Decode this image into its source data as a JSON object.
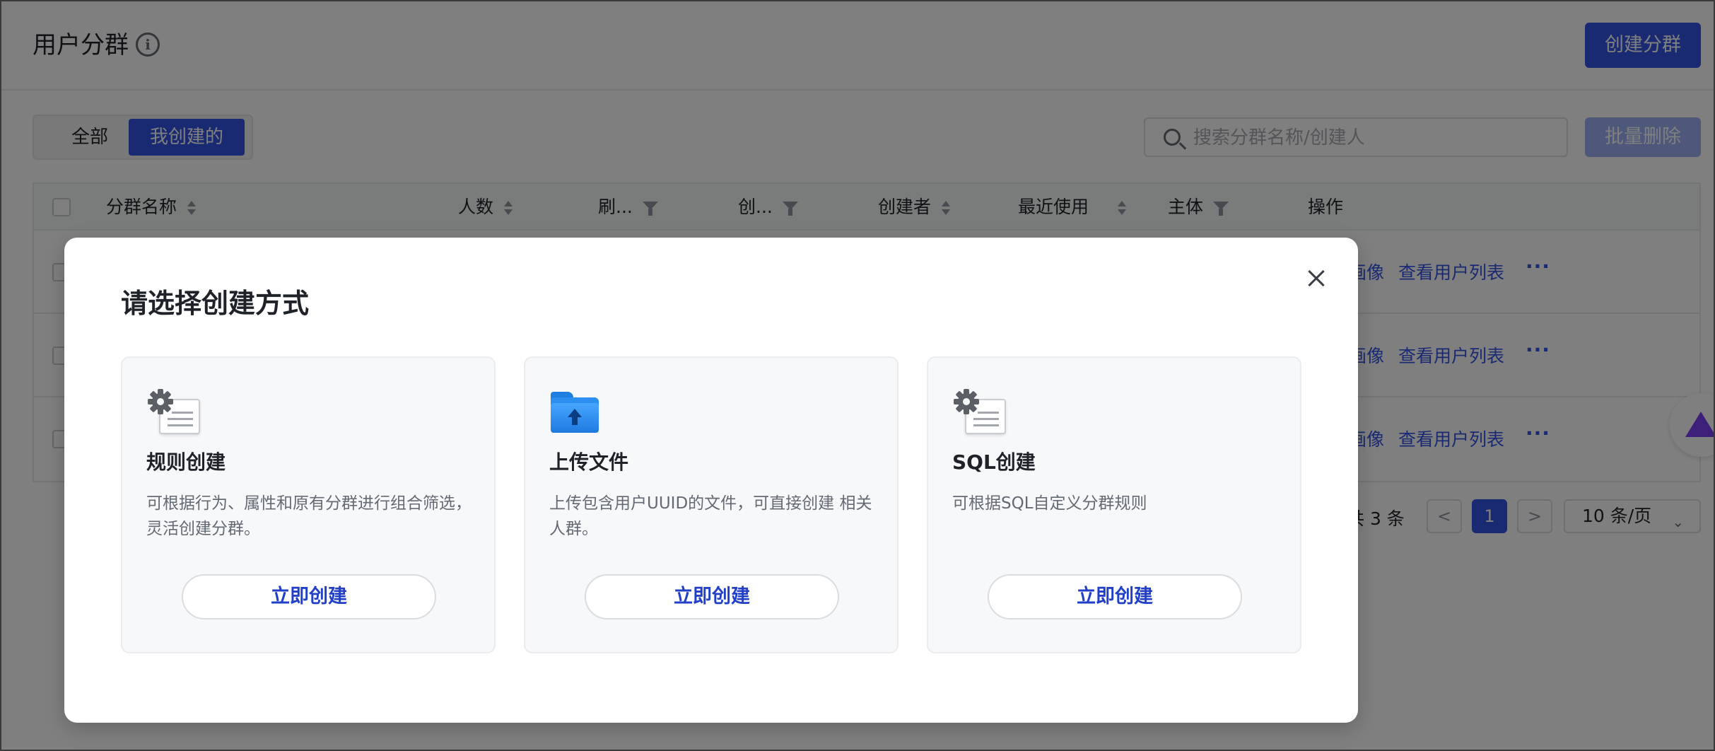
{
  "header": {
    "title": "用户分群",
    "create_button": "创建分群"
  },
  "filters": {
    "tabs": [
      "全部",
      "我创建的"
    ],
    "active_tab": "我创建的",
    "search_placeholder": "搜索分群名称/创建人",
    "batch_delete": "批量删除"
  },
  "table": {
    "columns": [
      "分群名称",
      "人数",
      "刷...",
      "创...",
      "创建者",
      "最近使用",
      "主体",
      "操作"
    ],
    "row_actions": {
      "portrait_partial": "画像",
      "view_users": "查看用户列表",
      "more": "···"
    },
    "row_count": 3
  },
  "pagination": {
    "total_partial": "共 3 条",
    "prev": "<",
    "current_page": "1",
    "next": ">",
    "page_size": "10 条/页"
  },
  "modal": {
    "title": "请选择创建方式",
    "close_icon": "close-icon",
    "cards": [
      {
        "icon": "gear-document-icon",
        "title": "规则创建",
        "description": "可根据行为、属性和原有分群进行组合筛选，灵活创建分群。",
        "button": "立即创建"
      },
      {
        "icon": "upload-folder-icon",
        "title": "上传文件",
        "description": "上传包含用户UUID的文件，可直接创建 相关人群。",
        "button": "立即创建"
      },
      {
        "icon": "gear-document-icon",
        "title": "SQL创建",
        "description": "可根据SQL自定义分群规则",
        "button": "立即创建"
      }
    ]
  },
  "colors": {
    "primary": "#3355e5",
    "overlay": "rgba(0,0,0,0.5)",
    "card_bg": "#f7f8fa"
  }
}
